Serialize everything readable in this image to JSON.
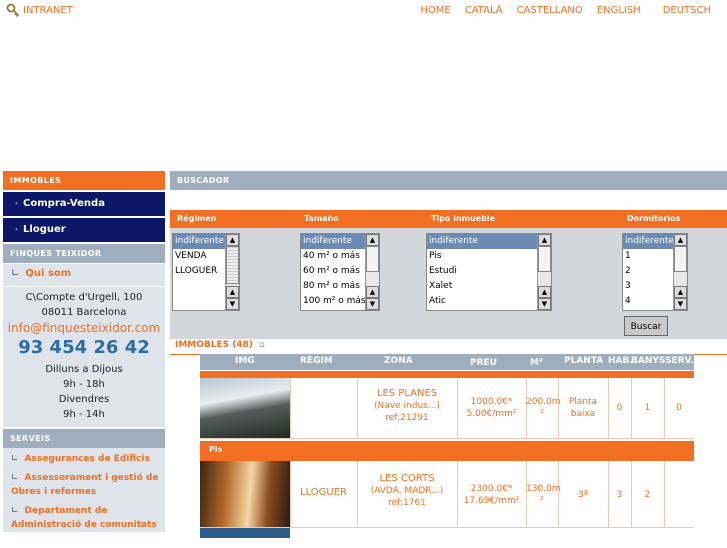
{
  "header": {
    "logo_text": "INTRANET",
    "nav": [
      "HOME",
      "CATALÀ",
      "CASTELLANO",
      "ENGLISH",
      "DEUTSCH"
    ]
  },
  "sidebar": {
    "immobles_title": "IMMOBLES",
    "menu": [
      "Compra-Venda",
      "Lloguer"
    ],
    "company_title": "FINQUES TEIXIDOR",
    "about_link": "Qui som",
    "address_line1": "C\\Compte d'Urgell, 100",
    "address_line2": "08011 Barcelona",
    "email": "info@finquesteixidor.com",
    "phone": "93 454 26 42",
    "hours_days1": "Dilluns a Dijous",
    "hours_time1": "9h - 18h",
    "hours_days2": "Divendres",
    "hours_time2": "9h - 14h",
    "services_title": "SERVEIS",
    "services": [
      "Assegurances de Edificis",
      "Assessorament i gestió de Obres i reformes",
      "Departament de Administració de comunitats"
    ]
  },
  "search": {
    "title": "BUSCADOR",
    "labels": [
      "Régimen",
      "Tamaño",
      "Tipo inmueble",
      "Dormitorios"
    ],
    "regimen_options": [
      "indiferente",
      "VENDA",
      "LLOGUER"
    ],
    "tamano_options": [
      "indiferente",
      "40 m² o más",
      "60 m² o más",
      "80 m² o más",
      "100 m² o más"
    ],
    "tipo_options": [
      "indiferente",
      "Pis",
      "Estudi",
      "Xalet",
      "Atic"
    ],
    "dormitorios_options": [
      "indiferente",
      "1",
      "2",
      "3",
      "4"
    ],
    "button": "Buscar"
  },
  "results": {
    "tab_label": "IMMOBLES (48)",
    "columns": [
      "IMG",
      "RÈGIM",
      "ZONA",
      "PREU",
      "M²",
      "PLANTA",
      "HAB.",
      "BANYS",
      "SERV."
    ],
    "rows": [
      {
        "regim": "",
        "zona": "LES PLANES",
        "zona_detail": "(Nave indus...)",
        "ref": "ref:21291",
        "preu": "1000.0€*",
        "preu_m2": "5.00€/mm²",
        "m2": "200.0m",
        "m2_unit": "²",
        "planta_line1": "Planta",
        "planta_line2": "baixa",
        "hab": "0",
        "banys": "1",
        "serv": "0"
      },
      {
        "type_label": "Pis",
        "regim": "LLOGUER",
        "zona": "LES CORTS",
        "zona_detail": "(AVDA. MADR...)",
        "ref": "ref:1761",
        "preu": "2300.0€*",
        "preu_m2": "17.69€/mm²",
        "m2": "130.0m",
        "m2_unit": "²",
        "planta_line1": "3ª",
        "planta_line2": "",
        "hab": "3",
        "banys": "2",
        "serv": ""
      }
    ]
  },
  "colors": {
    "accent": "#f26f21",
    "navy": "#0d1767",
    "grey_bar": "#9eaebf",
    "phone": "#2b6da8"
  }
}
